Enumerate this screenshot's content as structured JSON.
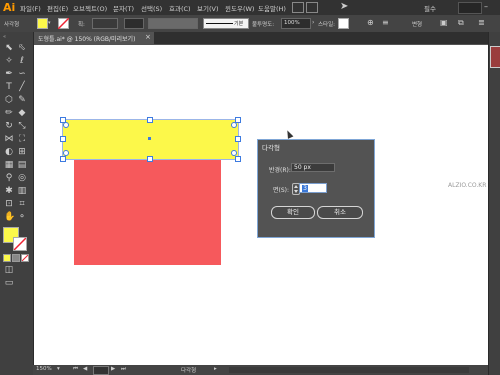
{
  "app": {
    "logo": "Ai",
    "accent": "#ff9a00"
  },
  "menu": {
    "items": [
      "파일(F)",
      "편집(E)",
      "오브젝트(O)",
      "문자(T)",
      "선택(S)",
      "효과(C)",
      "보기(V)",
      "윈도우(W)",
      "도움말(H)"
    ],
    "workspace": "필수"
  },
  "control_bar": {
    "selection_label": "사각형",
    "fill_color": "#fcf84a",
    "stroke_label": "획:",
    "stroke_profile": "기본",
    "opacity_label": "불투명도:",
    "opacity_value": "100%",
    "style_label": "스타일:",
    "transform_label": "변형"
  },
  "tab": {
    "title": "도형틀.ai* @ 150% (RGB/미리보기)"
  },
  "status": {
    "zoom": "150%",
    "tool_name": "다각형"
  },
  "canvas": {
    "watermark": "ALZIO.CO.KR",
    "yellow_rect_color": "#fcf84a",
    "red_rect_color": "#f6595c"
  },
  "dialog": {
    "title": "다각형",
    "radius_label": "반경(R):",
    "radius_value": "50 px",
    "sides_label": "면(S):",
    "sides_value": "3",
    "ok_label": "확인",
    "cancel_label": "취소"
  },
  "toolbar": {
    "tools": [
      "selection-tool",
      "direct-selection-tool",
      "magic-wand-tool",
      "lasso-tool",
      "pen-tool",
      "curvature-tool",
      "type-tool",
      "line-tool",
      "polygon-tool",
      "paintbrush-tool",
      "pencil-tool",
      "eraser-tool",
      "rotate-tool",
      "scale-tool",
      "width-tool",
      "free-transform-tool",
      "shape-builder-tool",
      "perspective-tool",
      "mesh-tool",
      "gradient-tool",
      "eyedropper-tool",
      "blend-tool",
      "symbol-sprayer-tool",
      "graph-tool",
      "artboard-tool",
      "slice-tool",
      "hand-tool",
      "zoom-tool"
    ],
    "fill_swatch": "#fcf84a"
  }
}
